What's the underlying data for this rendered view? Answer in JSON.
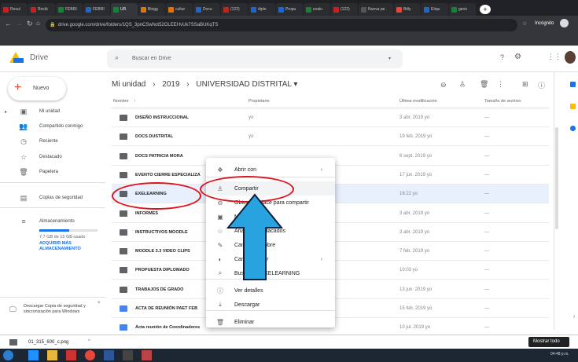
{
  "browser": {
    "tabs": [
      "Resul",
      "Recib",
      "FEBRI",
      "FEBRI",
      "UR",
      "Blogg",
      "cultur",
      "Docu",
      "(122)",
      "diplo",
      "Propu",
      "evalu",
      "(122)",
      "Nueva pe",
      "Bitly",
      "Etiqu",
      "gene"
    ],
    "url": "drive.google.com/drive/folders/1QS_3pnCSwhot52OLEEHvUk7SSaBUKqTS",
    "incognito_label": "Incógnito"
  },
  "drive": {
    "app_name": "Drive",
    "search_placeholder": "Buscar en Drive",
    "new_button": "Nuevo",
    "nav": [
      {
        "label": "Mi unidad",
        "icon": "drive-icon"
      },
      {
        "label": "Compartido conmigo",
        "icon": "people-icon"
      },
      {
        "label": "Reciente",
        "icon": "clock-icon"
      },
      {
        "label": "Destacado",
        "icon": "star-icon"
      },
      {
        "label": "Papelera",
        "icon": "trash-icon"
      },
      {
        "label": "Copias de seguridad",
        "icon": "backup-icon"
      },
      {
        "label": "Almacenamiento",
        "icon": "storage-icon"
      }
    ],
    "storage_used": "7,7 GB de 15 GB usado",
    "storage_fraction": 0.51,
    "buy_storage": "ADQUIRIR MÁS ALMACENAMIENTO",
    "backup_promo": "Descargar Copia de seguridad y sincronización para Windows",
    "breadcrumb": [
      "Mi unidad",
      "2019",
      "UNIVERSIDAD DISTRITAL"
    ],
    "columns": {
      "name": "Nombre",
      "owner": "Propietario",
      "modified": "Última modificación",
      "size": "Tamaño de archivo"
    },
    "files": [
      {
        "name": "DISEÑO INSTRUCCIONAL",
        "owner": "yo",
        "modified": "3 abr. 2019 yo",
        "size": "—"
      },
      {
        "name": "DOCS DUSTRITAL",
        "owner": "yo",
        "modified": "19 feb. 2019 yo",
        "size": "—"
      },
      {
        "name": "DOCS PATRICIA MORA",
        "owner": "",
        "modified": "6 sept. 2019 yo",
        "size": "—"
      },
      {
        "name": "EVENTO CIERRE ESPECIALIZA",
        "owner": "",
        "modified": "17 jun. 2019 yo",
        "size": "—"
      },
      {
        "name": "EXELEARNING",
        "owner": "",
        "modified": "16:22 yo",
        "size": "—"
      },
      {
        "name": "INFORMES",
        "owner": "",
        "modified": "3 abr. 2019 yo",
        "size": "—"
      },
      {
        "name": "INSTRUCTIVOS MOODLE",
        "owner": "",
        "modified": "3 abr. 2019 yo",
        "size": "—"
      },
      {
        "name": "MOODLE 3.3 VIDEO CLIPS",
        "owner": "",
        "modified": "7 feb. 2019 yo",
        "size": "—"
      },
      {
        "name": "PROPUESTA DIPLOMADO",
        "owner": "",
        "modified": "10:03 yo",
        "size": "—"
      },
      {
        "name": "TRABAJOS DE GRADO",
        "owner": "",
        "modified": "13 jun. 2019 yo",
        "size": "—"
      },
      {
        "name": "ACTA DE REUNIÓN PAET FEB",
        "owner": "",
        "modified": "15 feb. 2019 yo",
        "size": "—"
      },
      {
        "name": "Acta reunión de Coordinadores",
        "owner": "",
        "modified": "10 jul. 2019 yo",
        "size": "—"
      }
    ],
    "context_menu": [
      {
        "label": "Abrir con",
        "icon": "move-icon",
        "submenu": true
      },
      {
        "label": "Compartir",
        "icon": "add-person-icon",
        "submenu": false
      },
      {
        "label": "Obtener enlace para compartir",
        "icon": "link-icon",
        "submenu": false
      },
      {
        "label": "Mover a",
        "icon": "folder-move-icon",
        "submenu": false
      },
      {
        "label": "Añadir a Destacados",
        "icon": "star-icon",
        "submenu": false
      },
      {
        "label": "Cambiar nombre",
        "icon": "pencil-icon",
        "submenu": false
      },
      {
        "label": "Cambiar color",
        "icon": "palette-icon",
        "submenu": true
      },
      {
        "label": "Buscar en EXELEARNING",
        "icon": "search-icon",
        "submenu": false
      },
      {
        "label": "Ver detalles",
        "icon": "info-icon",
        "submenu": false
      },
      {
        "label": "Descargar",
        "icon": "download-icon",
        "submenu": false
      },
      {
        "label": "Eliminar",
        "icon": "trash-icon",
        "submenu": false
      }
    ]
  },
  "download_bar": {
    "file": "01_315_600_c.png",
    "show_all": "Mostrar todo"
  },
  "taskbar": {
    "time": "04:48 p.m."
  },
  "colors": {
    "accent": "#1a73e8",
    "annotation_red": "#e0121b",
    "arrow": "#29a3e0"
  }
}
